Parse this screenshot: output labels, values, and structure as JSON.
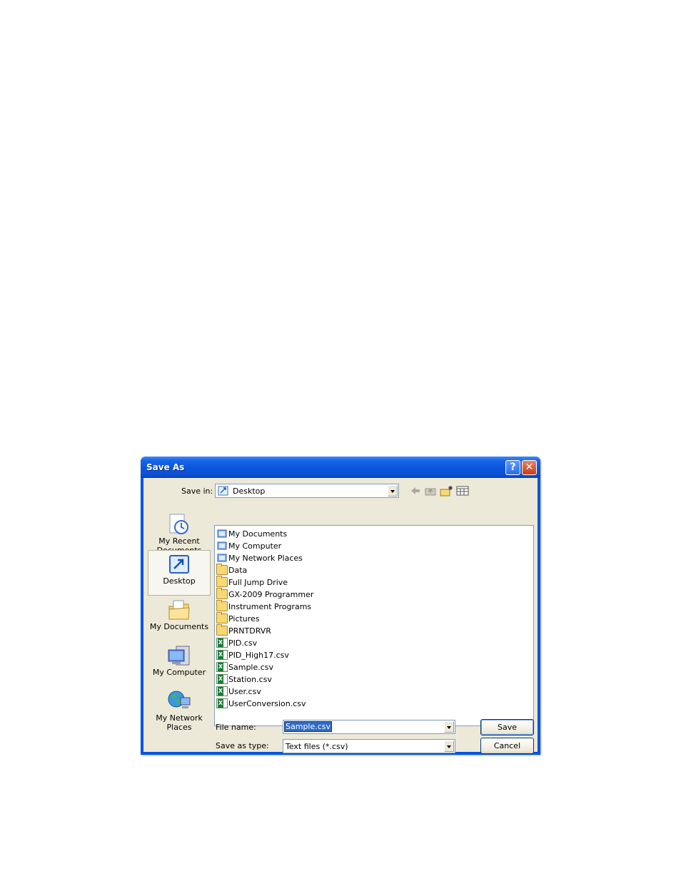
{
  "window": {
    "title": "Save As"
  },
  "titlebar": {
    "help": "?",
    "close": "✕"
  },
  "save_in": {
    "label": "Save in:",
    "value": "Desktop"
  },
  "places": [
    {
      "label_line1": "My Recent",
      "label_line2": "Documents",
      "icon": "recent-documents-icon",
      "selected": false
    },
    {
      "label_line1": "Desktop",
      "label_line2": "",
      "icon": "desktop-icon",
      "selected": true
    },
    {
      "label_line1": "My Documents",
      "label_line2": "",
      "icon": "my-documents-icon",
      "selected": false
    },
    {
      "label_line1": "My Computer",
      "label_line2": "",
      "icon": "my-computer-icon",
      "selected": false
    },
    {
      "label_line1": "My Network",
      "label_line2": "Places",
      "icon": "network-places-icon",
      "selected": false
    }
  ],
  "files": [
    {
      "name": "My Documents",
      "type": "special"
    },
    {
      "name": "My Computer",
      "type": "special"
    },
    {
      "name": "My Network Places",
      "type": "special"
    },
    {
      "name": "Data",
      "type": "folder"
    },
    {
      "name": "Full Jump Drive",
      "type": "folder"
    },
    {
      "name": "GX-2009 Programmer",
      "type": "folder"
    },
    {
      "name": "Instrument Programs",
      "type": "folder"
    },
    {
      "name": "Pictures",
      "type": "folder"
    },
    {
      "name": "PRNTDRVR",
      "type": "folder"
    },
    {
      "name": "PID.csv",
      "type": "csv"
    },
    {
      "name": "PID_High17.csv",
      "type": "csv"
    },
    {
      "name": "Sample.csv",
      "type": "csv"
    },
    {
      "name": "Station.csv",
      "type": "csv"
    },
    {
      "name": "User.csv",
      "type": "csv"
    },
    {
      "name": "UserConversion.csv",
      "type": "csv"
    }
  ],
  "file_name": {
    "label": "File name:",
    "value": "Sample.csv"
  },
  "save_as_type": {
    "label": "Save as type:",
    "value": "Text files (*.csv)"
  },
  "buttons": {
    "save": "Save",
    "cancel": "Cancel"
  }
}
